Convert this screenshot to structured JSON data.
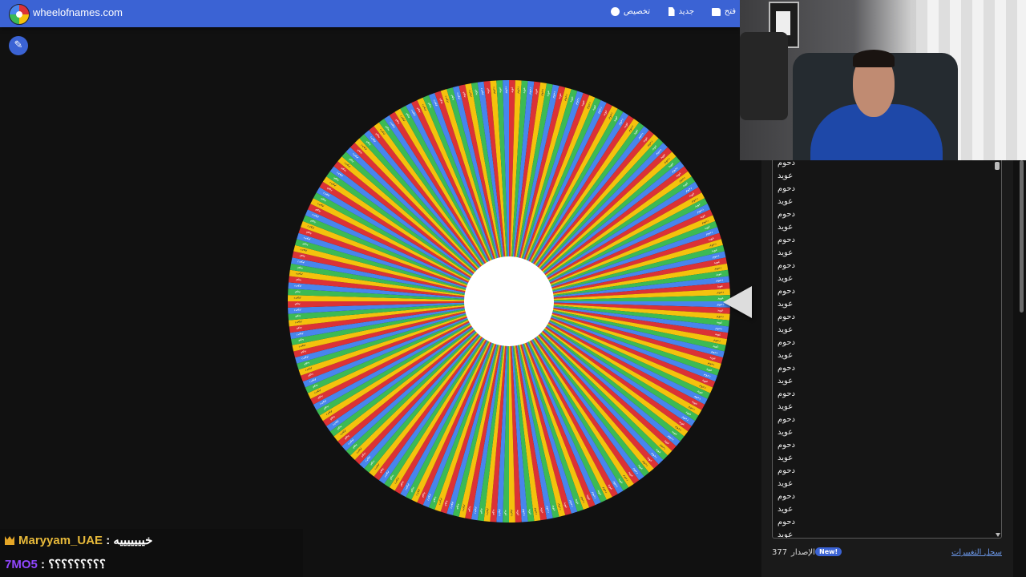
{
  "header": {
    "site_title": "wheelofnames.com",
    "open_label": "فتح",
    "new_label": "جديد",
    "customize_label": "تخصيص"
  },
  "wheel": {
    "slice_colors": [
      "#db3236",
      "#f4c20d",
      "#3cba54",
      "#4885ed"
    ],
    "slice_labels": [
      "عويد",
      "دحوم"
    ]
  },
  "entries_panel": {
    "entries": [
      "دحوم",
      "عويد",
      "دحوم",
      "عويد",
      "دحوم",
      "عويد",
      "دحوم",
      "عويد",
      "دحوم",
      "عويد",
      "دحوم",
      "عويد",
      "دحوم",
      "عويد",
      "دحوم",
      "عويد",
      "دحوم",
      "عويد",
      "دحوم",
      "عويد",
      "دحوم",
      "عويد",
      "دحوم",
      "عويد",
      "دحوم",
      "عويد",
      "دحوم",
      "عويد",
      "دحوم",
      "عويد"
    ]
  },
  "footer": {
    "version_number": "377",
    "version_label": "الإصدار",
    "new_badge": "New!",
    "changelog_link": "سجل التغييرات"
  },
  "chat": [
    {
      "user": "Maryyam_UAE",
      "message": " : خيييييييه",
      "user_color": "#e7b93a",
      "badge": "crown-icon"
    },
    {
      "user": "7MO5",
      "message": " : ؟؟؟؟؟؟؟؟؟",
      "user_color": "#9147ff"
    }
  ],
  "colors": {
    "header_bg": "#3b63d4",
    "page_bg": "#111111",
    "link": "#6a96e6"
  }
}
